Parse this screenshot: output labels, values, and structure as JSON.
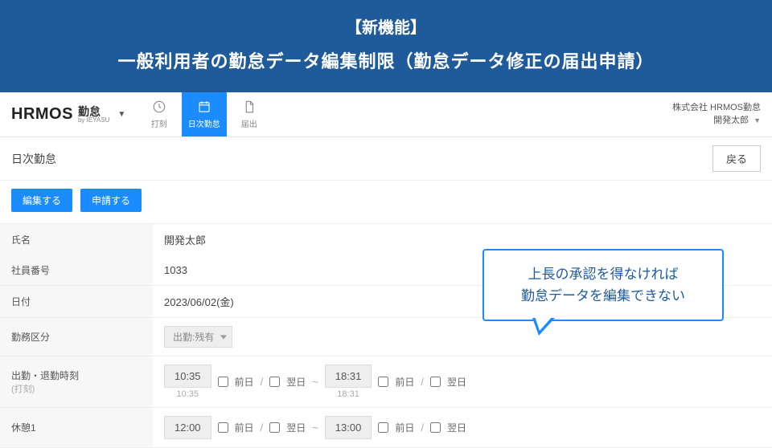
{
  "banner": {
    "line1": "【新機能】",
    "line2": "一般利用者の勤怠データ編集制限（勤怠データ修正の届出申請）"
  },
  "header": {
    "logo_main": "HRMOS",
    "logo_kanji": "勤怠",
    "logo_by": "by IEYASU",
    "tabs": {
      "clock": "打刻",
      "daily": "日次勤怠",
      "request": "届出"
    },
    "company": "株式会社 HRMOS勤怠",
    "user": "開発太郎"
  },
  "subhead": {
    "title": "日次勤怠",
    "back": "戻る"
  },
  "actions": {
    "edit": "編集する",
    "apply": "申請する"
  },
  "form": {
    "name_label": "氏名",
    "name_value": "開発太郎",
    "empno_label": "社員番号",
    "empno_value": "1033",
    "date_label": "日付",
    "date_value": "2023/06/02(金)",
    "worktype_label": "勤務区分",
    "worktype_value": "出勤:残有",
    "inout_label": "出勤・退勤時刻",
    "inout_hint": "(打刻)",
    "in_time": "10:35",
    "in_stamp": "10:35",
    "out_time": "18:31",
    "out_stamp": "18:31",
    "break_label": "休憩1",
    "break_start": "12:00",
    "break_end": "13:00",
    "prev_day": "前日",
    "next_day": "翌日",
    "slash": "/",
    "tilde": "~"
  },
  "callout": {
    "line1": "上長の承認を得なければ",
    "line2": "勤怠データを編集できない"
  }
}
